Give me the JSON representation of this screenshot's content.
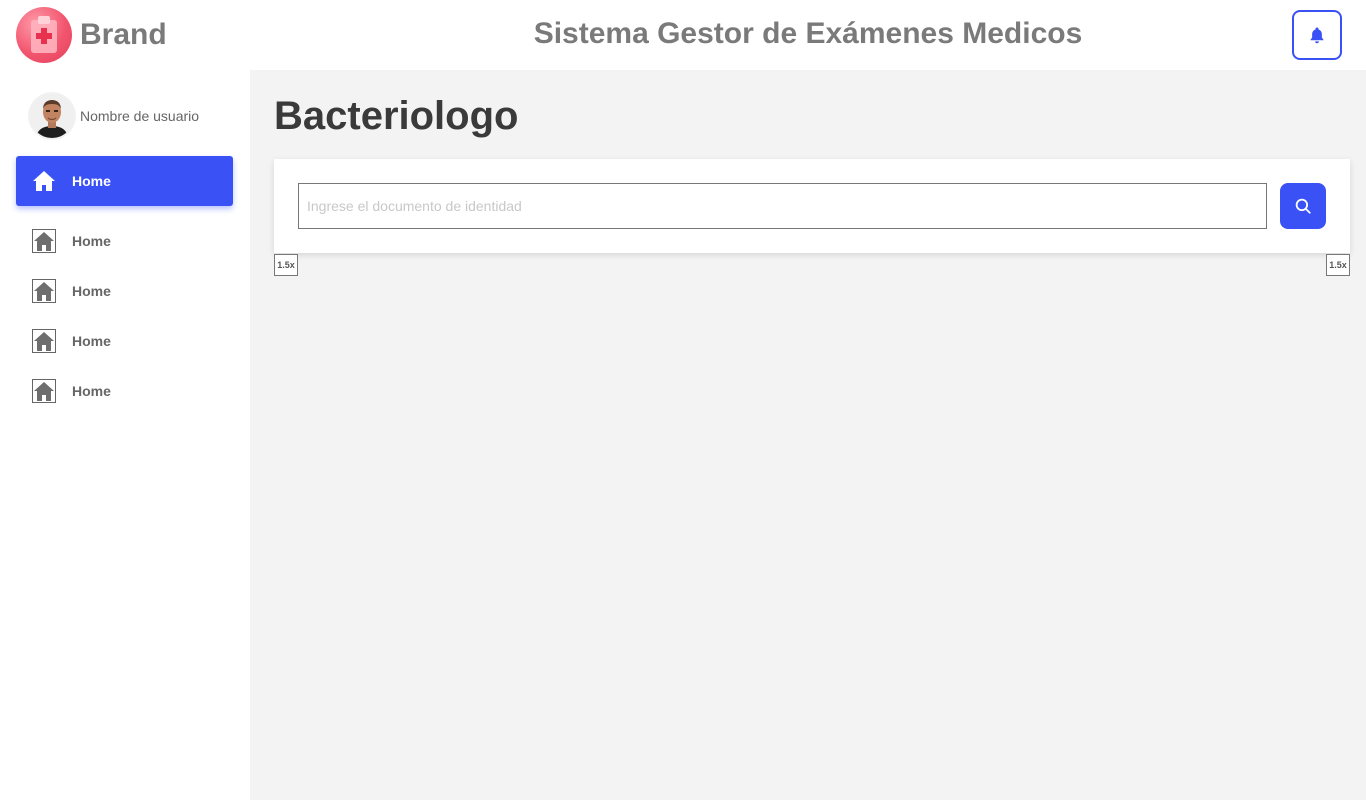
{
  "header": {
    "brand_name": "Brand",
    "app_title": "Sistema Gestor de Exámenes Medicos",
    "notifications_icon": "bell-icon",
    "logo_icon": "medical-clipboard-icon"
  },
  "sidebar": {
    "user": {
      "name": "Nombre de usuario",
      "avatar_icon": "user-avatar"
    },
    "items": [
      {
        "label": "Home",
        "icon": "home-icon",
        "active": true
      },
      {
        "label": "Home",
        "icon": "home-icon",
        "active": false
      },
      {
        "label": "Home",
        "icon": "home-icon",
        "active": false
      },
      {
        "label": "Home",
        "icon": "home-icon",
        "active": false
      },
      {
        "label": "Home",
        "icon": "home-icon",
        "active": false
      }
    ]
  },
  "main": {
    "title": "Bacteriologo",
    "search": {
      "placeholder": "Ingrese el documento de identidad",
      "value": "",
      "button_icon": "search-icon"
    },
    "zoom_left": "1.5x",
    "zoom_right": "1.5x"
  },
  "colors": {
    "accent": "#3a52f5",
    "brand_pink": "#f2566f",
    "main_bg": "#f3f3f3",
    "muted_text": "#7a7a7a"
  }
}
